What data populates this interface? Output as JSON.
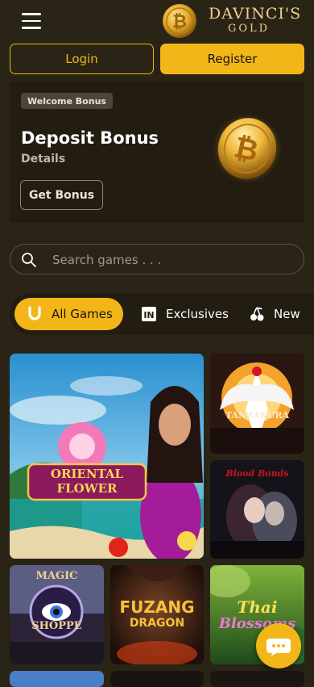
{
  "header": {
    "logo_text": "DAVINCI'S",
    "logo_sub": "GOLD"
  },
  "auth": {
    "login_label": "Login",
    "register_label": "Register"
  },
  "promo": {
    "badge": "Welcome Bonus",
    "title": "Deposit Bonus",
    "details": "Details",
    "button": "Get Bonus"
  },
  "search": {
    "placeholder": "Search games . . ."
  },
  "tabs": [
    {
      "label": "All Games",
      "icon": "horseshoe-icon",
      "active": true
    },
    {
      "label": "Exclusives",
      "icon": "in-badge-icon",
      "active": false
    },
    {
      "label": "New",
      "icon": "cherries-icon",
      "active": false
    }
  ],
  "games": [
    {
      "name": "Oriental Flower",
      "logo_line1": "ORIENTAL",
      "logo_line2": "FLOWER"
    },
    {
      "name": "Tanzakura",
      "logo_line1": "TANZAKURA"
    },
    {
      "name": "Blood Bonds",
      "logo_line1": "Blood Bonds"
    },
    {
      "name": "Magic Shoppe",
      "logo_line1": "MAGIC",
      "logo_line2": "SHOPPE"
    },
    {
      "name": "Fuzang Dragon",
      "logo_line1": "FUZANG",
      "logo_line2": "DRAGON"
    },
    {
      "name": "Thai Blossoms",
      "logo_line1": "Thai",
      "logo_line2": "Blossoms"
    }
  ],
  "colors": {
    "accent": "#f2b619",
    "background": "#2a2416",
    "panel": "#221c11"
  }
}
